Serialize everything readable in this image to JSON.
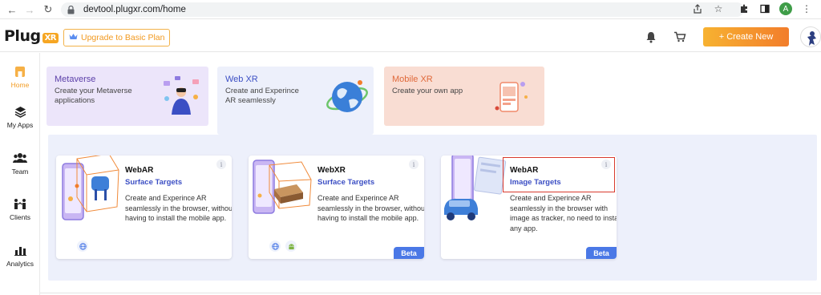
{
  "browser": {
    "url": "devtool.plugxr.com/home",
    "profile_initial": "A"
  },
  "header": {
    "logo_text": "Plug",
    "logo_badge": "XR",
    "upgrade_label": "Upgrade to Basic Plan",
    "create_label": "+ Create New"
  },
  "sidebar": {
    "items": [
      {
        "label": "Home",
        "icon": "home-icon",
        "active": true
      },
      {
        "label": "My Apps",
        "icon": "layers-icon",
        "active": false
      },
      {
        "label": "Team",
        "icon": "team-icon",
        "active": false
      },
      {
        "label": "Clients",
        "icon": "clients-icon",
        "active": false
      },
      {
        "label": "Analytics",
        "icon": "analytics-icon",
        "active": false
      }
    ]
  },
  "tabs": [
    {
      "title": "Metaverse",
      "desc": "Create your Metaverse applications",
      "color": "#ece5fa",
      "title_color": "#5b3fa8"
    },
    {
      "title": "Web XR",
      "desc": "Create and Experince AR seamlessly",
      "color": "#edf0fb",
      "title_color": "#3c4fc4"
    },
    {
      "title": "Mobile XR",
      "desc": "Create your own app",
      "color": "#f9ddd3",
      "title_color": "#e0693a"
    }
  ],
  "cards": [
    {
      "type": "WebAR",
      "subtitle": "Surface Targets",
      "desc": "Create and Experince AR seamlessly in the browser, without having to install the mobile app.",
      "beta": "",
      "platforms": [
        "web"
      ]
    },
    {
      "type": "WebXR",
      "subtitle": "Surface Targets",
      "desc": "Create and Experince AR seamlessly in the browser, without having to install the mobile app.",
      "beta": "Beta",
      "platforms": [
        "web",
        "android"
      ]
    },
    {
      "type": "WebAR",
      "subtitle": "Image Targets",
      "desc": "Create and Experince AR seamlessly in the browser with image as tracker, no need to install any app.",
      "beta": "Beta",
      "platforms": []
    }
  ],
  "colors": {
    "accent_orange": "#f39c23",
    "link_blue": "#3c4fc4",
    "beta_blue": "#4a78e6",
    "highlight_red": "#d93a2e"
  }
}
